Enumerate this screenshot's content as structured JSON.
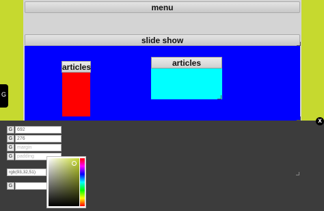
{
  "page": {
    "menu_label": "menu",
    "slideshow_label": "slide show",
    "boxes": [
      {
        "title": "articles",
        "color": "#ff0000"
      },
      {
        "title": "articles",
        "color": "#00ffff"
      }
    ],
    "stage_color": "#0000ff",
    "background_color": "#c6d92f"
  },
  "side_tab": {
    "icon": "G"
  },
  "close_button": {
    "label": "x"
  },
  "panel": {
    "fields": [
      {
        "icon": "G",
        "value": "692",
        "placeholder": ""
      },
      {
        "icon": "G",
        "value": "276",
        "placeholder": ""
      },
      {
        "icon": "G",
        "value": "",
        "placeholder": "margin"
      },
      {
        "icon": "G",
        "value": "",
        "placeholder": "padding"
      }
    ],
    "color_value": "rgb(93,32,51)",
    "picker_icon": "G"
  }
}
